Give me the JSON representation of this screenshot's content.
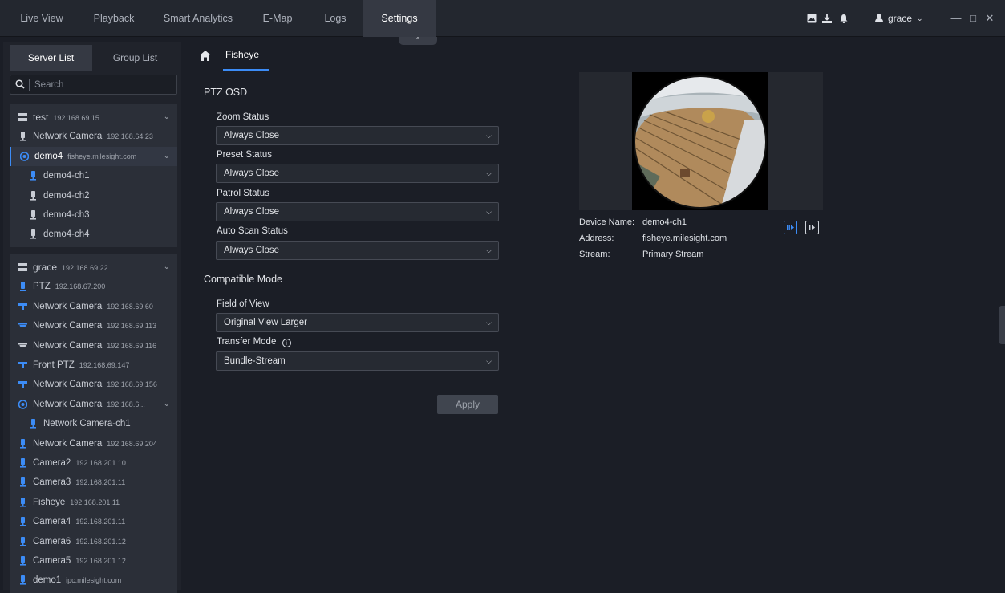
{
  "nav": {
    "tabs": [
      "Live View",
      "Playback",
      "Smart Analytics",
      "E-Map",
      "Logs",
      "Settings"
    ],
    "active_tab": "Settings",
    "user": "grace",
    "window_controls": [
      "minimize-icon",
      "maximize-icon",
      "close-icon"
    ]
  },
  "sidebar": {
    "tab_server": "Server List",
    "tab_group": "Group List",
    "search_placeholder": "Search",
    "groups": [
      {
        "server": {
          "name": "test",
          "ip": "192.168.69.15"
        },
        "devices": [
          {
            "name": "Network Camera",
            "ip": "192.168.64.23",
            "icon": "bullet-camera-icon",
            "color": "#c8ccd4"
          },
          {
            "name": "demo4",
            "ip": "fisheye.milesight.com",
            "icon": "fisheye-icon",
            "color": "#3c8cf6",
            "selected": true,
            "expand": true
          },
          {
            "name": "demo4-ch1",
            "ip": "",
            "icon": "channel-icon",
            "color": "#3c8cf6",
            "indent": true
          },
          {
            "name": "demo4-ch2",
            "ip": "",
            "icon": "channel-icon",
            "color": "#c8ccd4",
            "indent": true
          },
          {
            "name": "demo4-ch3",
            "ip": "",
            "icon": "channel-icon",
            "color": "#c8ccd4",
            "indent": true
          },
          {
            "name": "demo4-ch4",
            "ip": "",
            "icon": "channel-icon",
            "color": "#c8ccd4",
            "indent": true
          }
        ]
      },
      {
        "server": {
          "name": "grace",
          "ip": "192.168.69.22"
        },
        "devices": [
          {
            "name": "PTZ",
            "ip": "192.168.67.200",
            "icon": "ptz-camera-icon",
            "color": "#3c8cf6"
          },
          {
            "name": "Network Camera",
            "ip": "192.168.69.60",
            "icon": "turret-camera-icon",
            "color": "#3c8cf6"
          },
          {
            "name": "Network Camera",
            "ip": "192.168.69.113",
            "icon": "dome-camera-icon",
            "color": "#3c8cf6"
          },
          {
            "name": "Network Camera",
            "ip": "192.168.69.116",
            "icon": "dome-camera-icon",
            "color": "#c8ccd4"
          },
          {
            "name": "Front PTZ",
            "ip": "192.168.69.147",
            "icon": "turret-camera-icon",
            "color": "#3c8cf6"
          },
          {
            "name": "Network Camera",
            "ip": "192.168.69.156",
            "icon": "turret-camera-icon",
            "color": "#3c8cf6"
          },
          {
            "name": "Network Camera",
            "ip": "192.168.6...",
            "icon": "fisheye-icon",
            "color": "#3c8cf6",
            "expand": true
          },
          {
            "name": "Network Camera-ch1",
            "ip": "",
            "icon": "channel-icon",
            "color": "#3c8cf6",
            "indent": true
          },
          {
            "name": "Network Camera",
            "ip": "192.168.69.204",
            "icon": "bullet-camera-icon",
            "color": "#3c8cf6"
          },
          {
            "name": "Camera2",
            "ip": "192.168.201.10",
            "icon": "bullet-camera-icon",
            "color": "#3c8cf6"
          },
          {
            "name": "Camera3",
            "ip": "192.168.201.11",
            "icon": "bullet-camera-icon",
            "color": "#3c8cf6"
          },
          {
            "name": "Fisheye",
            "ip": "192.168.201.11",
            "icon": "bullet-camera-icon",
            "color": "#3c8cf6"
          },
          {
            "name": "Camera4",
            "ip": "192.168.201.11",
            "icon": "bullet-camera-icon",
            "color": "#3c8cf6"
          },
          {
            "name": "Camera6",
            "ip": "192.168.201.12",
            "icon": "bullet-camera-icon",
            "color": "#3c8cf6"
          },
          {
            "name": "Camera5",
            "ip": "192.168.201.12",
            "icon": "bullet-camera-icon",
            "color": "#3c8cf6"
          },
          {
            "name": "demo1",
            "ip": "ipc.milesight.com",
            "icon": "bullet-camera-icon",
            "color": "#3c8cf6"
          }
        ]
      }
    ]
  },
  "breadcrumb": {
    "tab": "Fisheye"
  },
  "form": {
    "ptz_osd_title": "PTZ OSD",
    "zoom_label": "Zoom Status",
    "zoom_value": "Always Close",
    "preset_label": "Preset Status",
    "preset_value": "Always Close",
    "patrol_label": "Patrol Status",
    "patrol_value": "Always Close",
    "autoscan_label": "Auto Scan Status",
    "autoscan_value": "Always Close",
    "compat_title": "Compatible Mode",
    "fov_label": "Field of View",
    "fov_value": "Original View Larger",
    "transfer_label": "Transfer Mode",
    "transfer_value": "Bundle-Stream",
    "apply_label": "Apply"
  },
  "device_info": {
    "name_label": "Device Name:",
    "name_value": "demo4-ch1",
    "address_label": "Address:",
    "address_value": "fisheye.milesight.com",
    "stream_label": "Stream:",
    "stream_value": "Primary Stream"
  },
  "accent_color": "#3c8cf6"
}
